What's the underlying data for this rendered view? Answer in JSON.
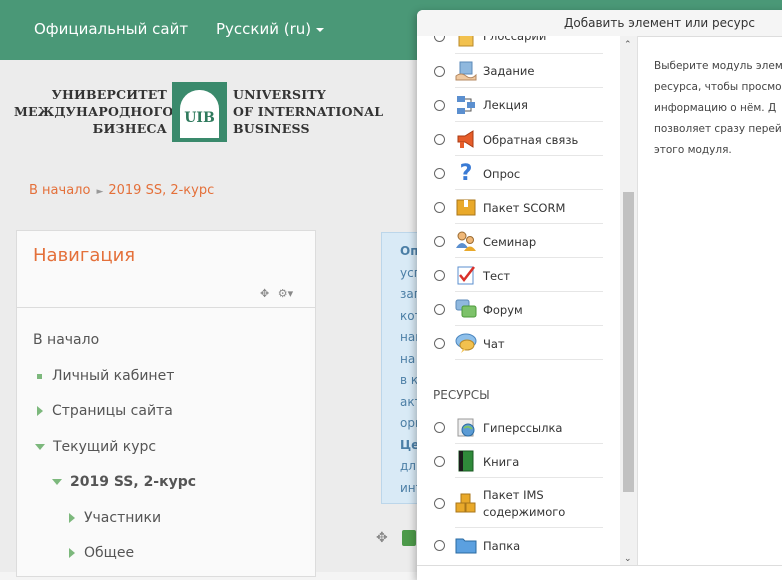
{
  "topbar": {
    "site_link": "Официальный сайт",
    "language": "Русский (ru)"
  },
  "logo": {
    "ru_lines": [
      "УНИВЕРСИТЕТ",
      "МЕЖДУНАРОДНОГО",
      "БИЗНЕСА"
    ],
    "emblem": "UIB",
    "en_lines": [
      "UNIVERSITY",
      "OF INTERNATIONAL",
      "BUSINESS"
    ]
  },
  "breadcrumb": [
    "В начало",
    "2019 SS, 2-курс"
  ],
  "navigation": {
    "title": "Навигация",
    "items": [
      {
        "label": "В начало",
        "marker": "none"
      },
      {
        "label": "Личный кабинет",
        "marker": "bullet"
      },
      {
        "label": "Страницы сайта",
        "marker": "collapsed"
      },
      {
        "label": "Текущий курс",
        "marker": "expanded"
      },
      {
        "label": "2019 SS, 2-курс",
        "marker": "expanded"
      },
      {
        "label": "Участники",
        "marker": "collapsed"
      },
      {
        "label": "Общее",
        "marker": "collapsed"
      }
    ]
  },
  "infobox": {
    "lines": [
      "Оп",
      "усг",
      "зап",
      "кот",
      "наг",
      "на",
      "в к",
      "акт",
      "орг",
      "Це",
      "дл:",
      "инт"
    ]
  },
  "modal": {
    "title": "Добавить элемент или ресурс",
    "activities": [
      {
        "label": "Глоссарий",
        "icon": "glossary-icon"
      },
      {
        "label": "Задание",
        "icon": "assignment-icon"
      },
      {
        "label": "Лекция",
        "icon": "lesson-icon"
      },
      {
        "label": "Обратная связь",
        "icon": "feedback-icon"
      },
      {
        "label": "Опрос",
        "icon": "choice-icon"
      },
      {
        "label": "Пакет SCORM",
        "icon": "scorm-icon"
      },
      {
        "label": "Семинар",
        "icon": "workshop-icon"
      },
      {
        "label": "Тест",
        "icon": "quiz-icon"
      },
      {
        "label": "Форум",
        "icon": "forum-icon"
      },
      {
        "label": "Чат",
        "icon": "chat-icon"
      }
    ],
    "resources_heading": "РЕСУРСЫ",
    "resources": [
      {
        "label": "Гиперссылка",
        "icon": "url-icon"
      },
      {
        "label": "Книга",
        "icon": "book-icon"
      },
      {
        "label": "Пакет IMS\nсодержимого",
        "icon": "ims-package-icon"
      },
      {
        "label": "Папка",
        "icon": "folder-icon"
      }
    ],
    "help_lines": [
      "Выберите модуль элем",
      "ресурса, чтобы просмо",
      "информацию о нём. Д",
      "позволяет сразу перейт",
      "этого модуля."
    ]
  }
}
